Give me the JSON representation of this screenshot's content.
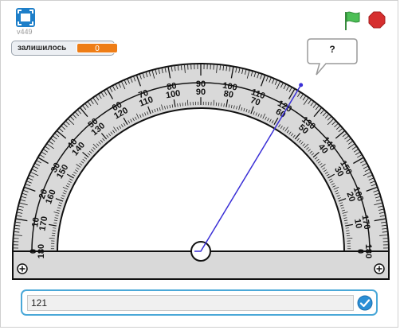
{
  "header": {
    "version": "v449",
    "fullscreen_icon": "fullscreen-icon",
    "green_flag_icon": "green-flag-icon",
    "stop_icon": "stop-sign-icon"
  },
  "monitor": {
    "label": "залишилось",
    "value": "0"
  },
  "speech_bubble": {
    "text": "?"
  },
  "protractor": {
    "outer_scale": [
      "0",
      "10",
      "20",
      "30",
      "40",
      "50",
      "60",
      "70",
      "80",
      "90",
      "100",
      "110",
      "120",
      "130",
      "140",
      "150",
      "160",
      "170",
      "180"
    ],
    "inner_scale": [
      "180",
      "170",
      "160",
      "150",
      "140",
      "130",
      "120",
      "110",
      "100",
      "90",
      "80",
      "70",
      "60",
      "50",
      "40",
      "30",
      "20",
      "10",
      "0"
    ],
    "pointer_angle_deg": 121,
    "pointer_color": "#3a2fd6"
  },
  "answer": {
    "value": "121",
    "submit_icon": "check-icon"
  },
  "colors": {
    "accent": "#4aa8d8",
    "monitor_value_bg": "#ee7d16",
    "flag": "#4cbf56",
    "stop": "#d62f2f"
  }
}
